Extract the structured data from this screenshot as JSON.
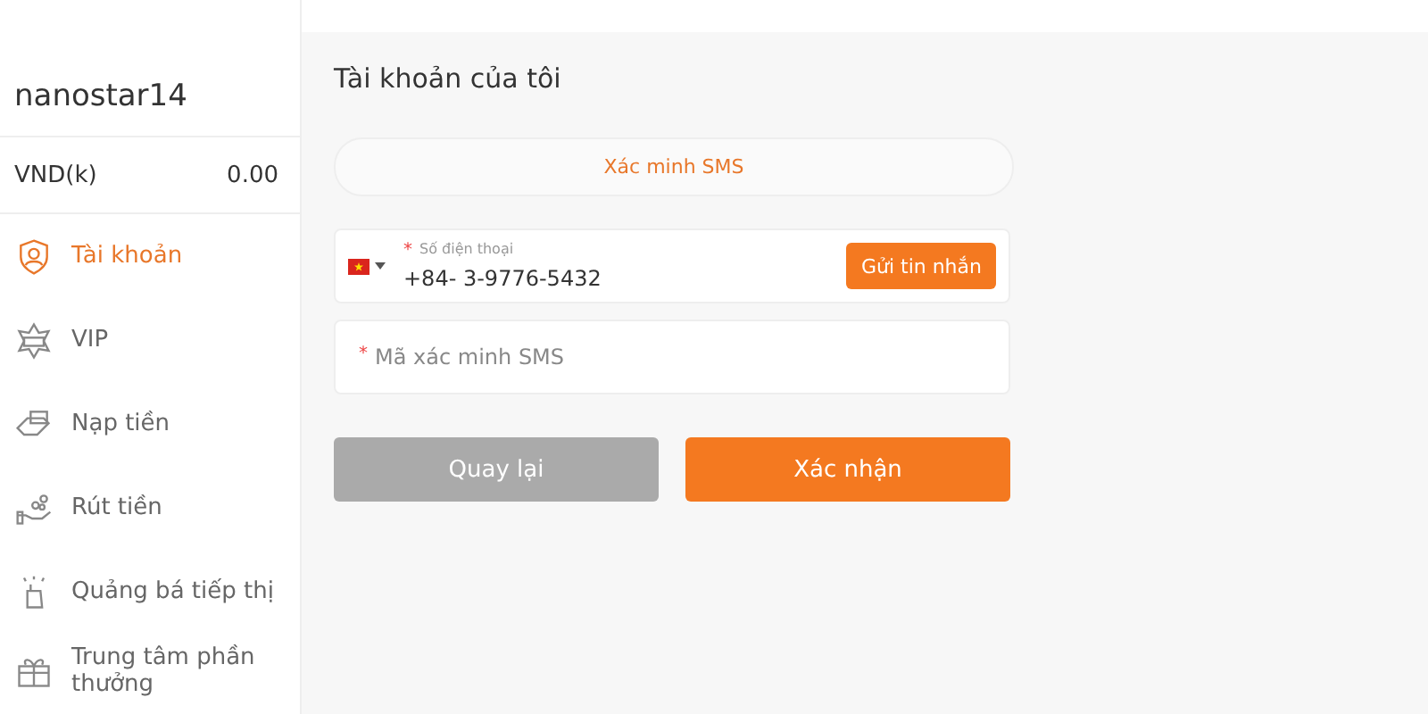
{
  "user": {
    "name": "nanostar14",
    "currency": "VND(k)",
    "balance": "0.00"
  },
  "sidebar": {
    "items": [
      {
        "kind": "account",
        "label": "Tài khoản",
        "selected": true
      },
      {
        "kind": "vip",
        "label": "VIP",
        "selected": false
      },
      {
        "kind": "deposit",
        "label": "Nạp tiền",
        "selected": false
      },
      {
        "kind": "withdraw",
        "label": "Rút tiền",
        "selected": false
      },
      {
        "kind": "promote",
        "label": "Quảng bá tiếp thị",
        "selected": false
      },
      {
        "kind": "gift",
        "label": "Trung tâm phần thưởng",
        "selected": false
      }
    ]
  },
  "main": {
    "title": "Tài khoản của tôi",
    "tab": "Xác minh SMS",
    "phone": {
      "required_mark": "*",
      "label": "Số điện thoại",
      "value": "+84- 3-9776-5432",
      "send_button": "Gửi tin nhắn"
    },
    "code": {
      "required_mark": "*",
      "placeholder": "Mã xác minh SMS"
    },
    "back_button": "Quay lại",
    "confirm_button": "Xác nhận"
  }
}
